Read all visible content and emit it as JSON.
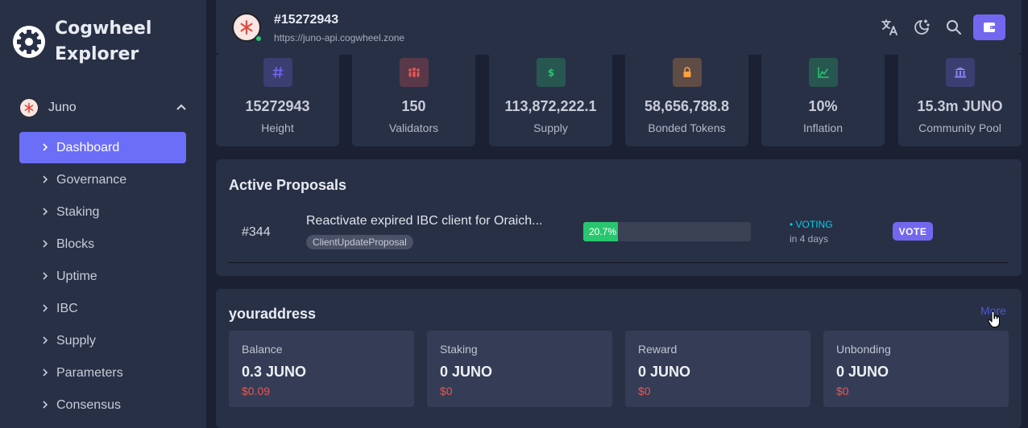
{
  "brand": {
    "name": "Cogwheel Explorer"
  },
  "sidebar": {
    "chain": {
      "name": "Juno"
    },
    "items": [
      {
        "label": "Dashboard",
        "active": true
      },
      {
        "label": "Governance"
      },
      {
        "label": "Staking"
      },
      {
        "label": "Blocks"
      },
      {
        "label": "Uptime"
      },
      {
        "label": "IBC"
      },
      {
        "label": "Supply"
      },
      {
        "label": "Parameters"
      },
      {
        "label": "Consensus"
      }
    ]
  },
  "header": {
    "block_id": "#15272943",
    "endpoint": "https://juno-api.cogwheel.zone",
    "icons": [
      "translate-icon",
      "theme-toggle-icon",
      "search-icon",
      "wallet-icon"
    ]
  },
  "stats": [
    {
      "value": "15272943",
      "label": "Height",
      "icon": "hash-icon",
      "color": "#7367f0"
    },
    {
      "value": "150",
      "label": "Validators",
      "icon": "people-icon",
      "color": "#ea5455"
    },
    {
      "value": "113,872,222.1",
      "label": "Supply",
      "icon": "dollar-icon",
      "color": "#28c76f"
    },
    {
      "value": "58,656,788.8",
      "label": "Bonded Tokens",
      "icon": "lock-icon",
      "color": "#ff9f43"
    },
    {
      "value": "10%",
      "label": "Inflation",
      "icon": "chart-icon",
      "color": "#28c76f"
    },
    {
      "value": "15.3m JUNO",
      "label": "Community Pool",
      "icon": "bank-icon",
      "color": "#7367f0"
    }
  ],
  "proposals": {
    "title": "Active Proposals",
    "items": [
      {
        "id": "#344",
        "title": "Reactivate expired IBC client for Oraich...",
        "tag": "ClientUpdateProposal",
        "progress": "20.7%",
        "progress_fraction": 0.207,
        "status": "VOTING",
        "time": "in 4 days",
        "action": "VOTE"
      }
    ]
  },
  "address": {
    "title": "youraddress",
    "more": "More",
    "balances": [
      {
        "label": "Balance",
        "amount": "0.3 JUNO",
        "usd": "$0.09"
      },
      {
        "label": "Staking",
        "amount": "0 JUNO",
        "usd": "$0"
      },
      {
        "label": "Reward",
        "amount": "0 JUNO",
        "usd": "$0"
      },
      {
        "label": "Unbonding",
        "amount": "0 JUNO",
        "usd": "$0"
      }
    ]
  },
  "colors": {
    "accent": "#7367f0",
    "active_nav": "#6b6ef7",
    "success": "#28c76f",
    "danger": "#ea5455",
    "info": "#00cfe8"
  }
}
